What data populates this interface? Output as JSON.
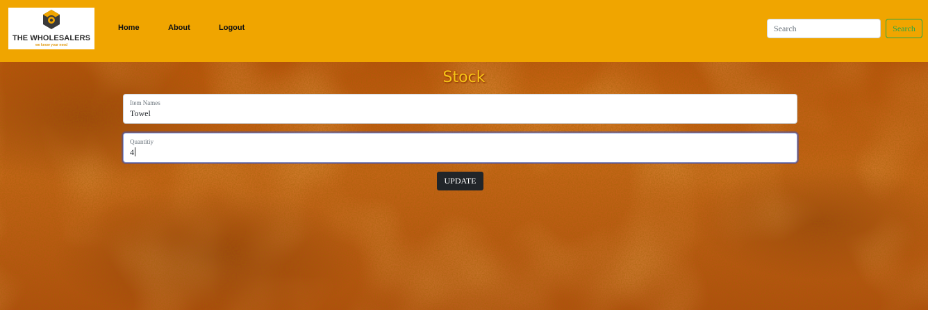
{
  "brand": {
    "name": "THE WHOLESALERS",
    "tagline": "we know your need",
    "logo_icon": "hexagon-pin-icon",
    "accent_color": "#f0a500"
  },
  "nav": {
    "items": [
      {
        "label": "Home"
      },
      {
        "label": "About"
      },
      {
        "label": "Logout"
      }
    ]
  },
  "search": {
    "placeholder": "Search",
    "button_label": "Search",
    "button_color": "#28a745"
  },
  "form": {
    "heading": "Stock",
    "fields": [
      {
        "label": "Item Names",
        "value": "Towel"
      },
      {
        "label": "Quantitiy",
        "value": "4"
      }
    ],
    "submit_label": "UPDATE"
  }
}
